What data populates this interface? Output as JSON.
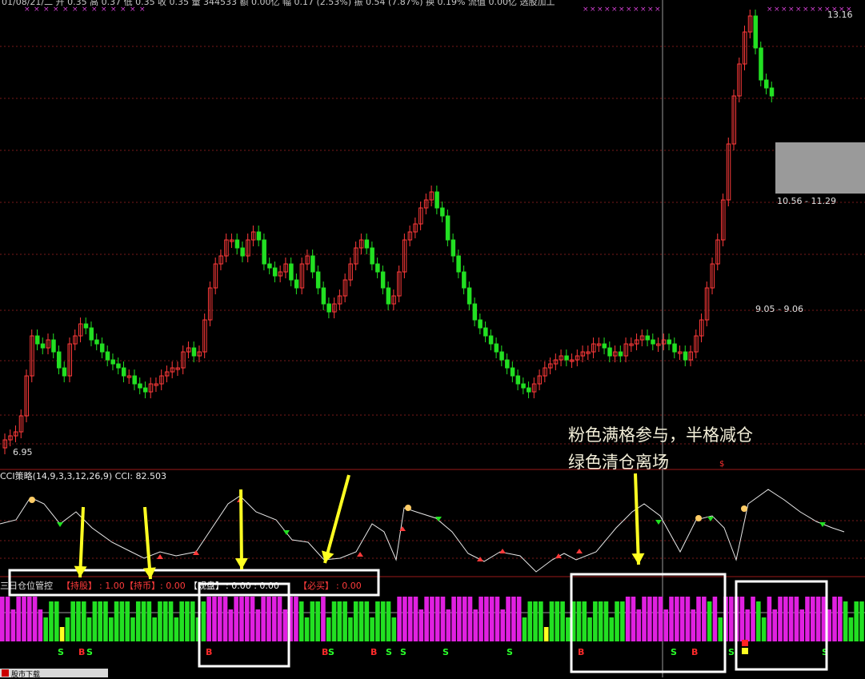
{
  "header": {
    "text": "01/08/21/二 开 0.35 高 0.37 低 0.35 收 0.35 量 344533 额 0.00亿 幅 0.17 (2.53%) 振 0.54 (7.87%) 换 0.19% 流值 0.00亿 选股加工"
  },
  "price_labels": {
    "high": "13.16",
    "band_high": "10.56 - 11.29",
    "band_low": "9.05 - 9.06",
    "low": "6.95"
  },
  "annotation": {
    "line1": "粉色满格参与，半格减仓",
    "line2": "绿色清仓离场"
  },
  "indicator": {
    "title": "CCI策略(14,9,3,3,12,26,9)  CCI: 82.503",
    "marker": "$"
  },
  "position_panel": {
    "title": "三日仓位管控",
    "hold_label": "【持股】",
    "hold_value": ": 1.00",
    "cash_label": "【持币】",
    "cash_value": ": 0.00",
    "watch_label": "【观盘】",
    "watch_value": ": 0.00 : 0.00",
    "buy_label": "【必买】",
    "buy_value": ": 0.00"
  },
  "signals": {
    "buy": "B",
    "sell": "S"
  },
  "taskbar": {
    "label": "股市下载"
  },
  "colors": {
    "up": "#ff3a3a",
    "down": "#22e022",
    "pink": "#e020e0",
    "green": "#22e022",
    "yellow": "#ffff22",
    "frame": "#ffffff"
  }
}
